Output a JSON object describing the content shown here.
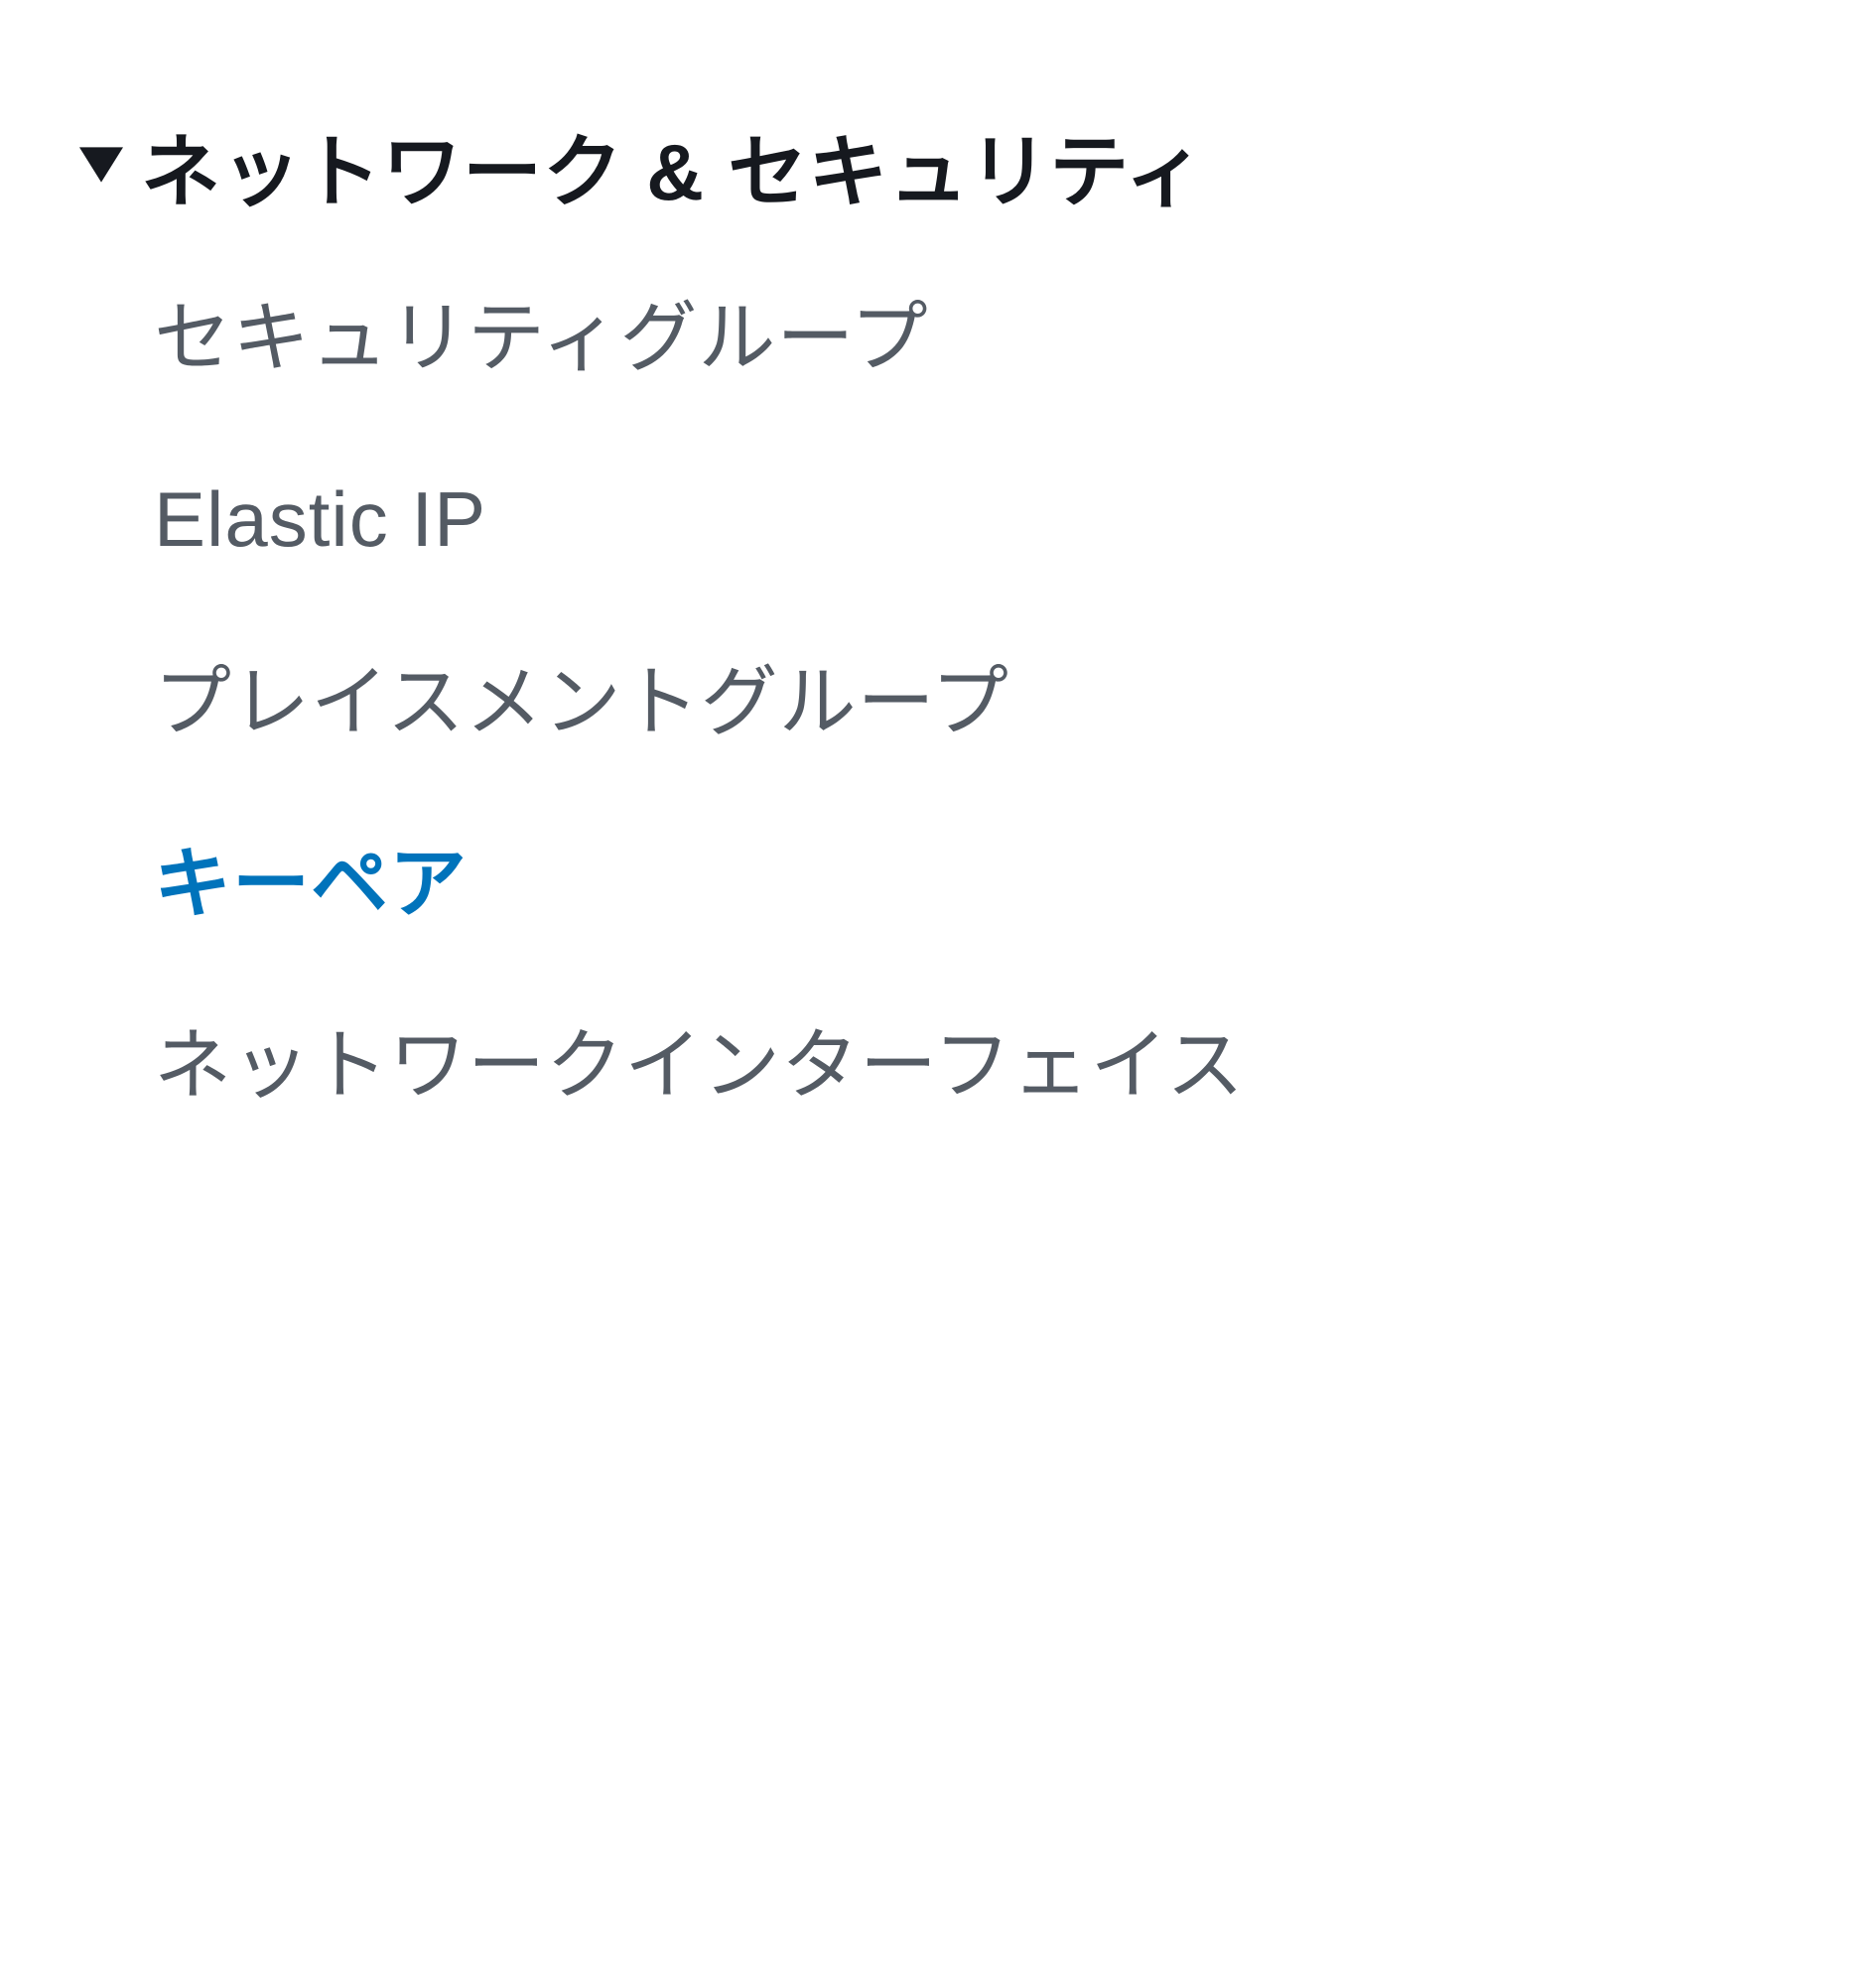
{
  "sidebar": {
    "section": {
      "title": "ネットワーク & セキュリティ",
      "expanded": true,
      "items": [
        {
          "label": "セキュリティグループ",
          "active": false
        },
        {
          "label": "Elastic IP",
          "active": false
        },
        {
          "label": "プレイスメントグループ",
          "active": false
        },
        {
          "label": "キーペア",
          "active": true
        },
        {
          "label": "ネットワークインターフェイス",
          "active": false
        }
      ]
    }
  }
}
